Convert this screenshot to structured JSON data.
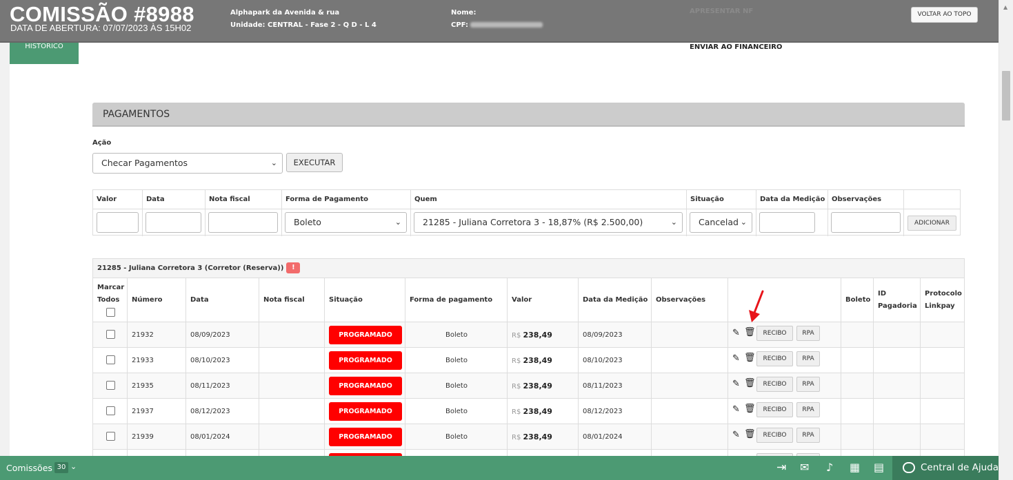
{
  "header": {
    "title": "COMISSÃO #8988",
    "subtitle": "DATA DE ABERTURA: 07/07/2023 ÀS 15H02",
    "empreendimento": "Alphapark da Avenida & rua",
    "unidade_label": "Unidade:",
    "unidade_value": "CENTRAL - Fase 2 - Q D - L 4",
    "nome_label": "Nome:",
    "cpf_label": "CPF:",
    "apresentar_nf": "APRESENTAR NF",
    "voltar_topo": "VOLTAR AO TOPO"
  },
  "tabs": {
    "historico": "HISTÓRICO"
  },
  "enviar_financeiro": "ENVIAR AO FINANCEIRO",
  "pagamentos": {
    "title": "PAGAMENTOS",
    "acao_label": "Ação",
    "acao_value": "Checar Pagamentos",
    "executar": "EXECUTAR"
  },
  "add_form": {
    "headers": [
      "Valor",
      "Data",
      "Nota fiscal",
      "Forma de Pagamento",
      "Quem",
      "Situação",
      "Data da Medição",
      "Observações"
    ],
    "forma_value": "Boleto",
    "quem_value": "21285 - Juliana Corretora 3 - 18,87% (R$ 2.500,00)",
    "situacao_value": "Cancelad",
    "adicionar": "ADICIONAR"
  },
  "group": {
    "title": "21285 - Juliana Corretora 3 (Corretor (Reserva))",
    "warn": "!",
    "headers": {
      "marcar": "Marcar Todos",
      "numero": "Número",
      "data": "Data",
      "nota": "Nota fiscal",
      "situacao": "Situação",
      "forma": "Forma de pagamento",
      "valor": "Valor",
      "medicao": "Data da Medição",
      "obs": "Observações",
      "boleto": "Boleto",
      "idpag": "ID Pagadoria",
      "protocolo": "Protocolo Linkpay"
    },
    "rows": [
      {
        "numero": "21932",
        "data": "08/09/2023",
        "situacao": "PROGRAMADO",
        "forma": "Boleto",
        "currency": "R$",
        "valor": "238,49",
        "medicao": "08/09/2023"
      },
      {
        "numero": "21933",
        "data": "08/10/2023",
        "situacao": "PROGRAMADO",
        "forma": "Boleto",
        "currency": "R$",
        "valor": "238,49",
        "medicao": "08/10/2023"
      },
      {
        "numero": "21935",
        "data": "08/11/2023",
        "situacao": "PROGRAMADO",
        "forma": "Boleto",
        "currency": "R$",
        "valor": "238,49",
        "medicao": "08/11/2023"
      },
      {
        "numero": "21937",
        "data": "08/12/2023",
        "situacao": "PROGRAMADO",
        "forma": "Boleto",
        "currency": "R$",
        "valor": "238,49",
        "medicao": "08/12/2023"
      },
      {
        "numero": "21939",
        "data": "08/01/2024",
        "situacao": "PROGRAMADO",
        "forma": "Boleto",
        "currency": "R$",
        "valor": "238,49",
        "medicao": "08/01/2024"
      }
    ],
    "recibo": "RECIBO",
    "rpa": "RPA"
  },
  "bottom_bar": {
    "comissoes_label": "Comissões",
    "comissoes_count": "30",
    "help_label": "Central de Ajuda",
    "accent": "#4c9a73"
  }
}
